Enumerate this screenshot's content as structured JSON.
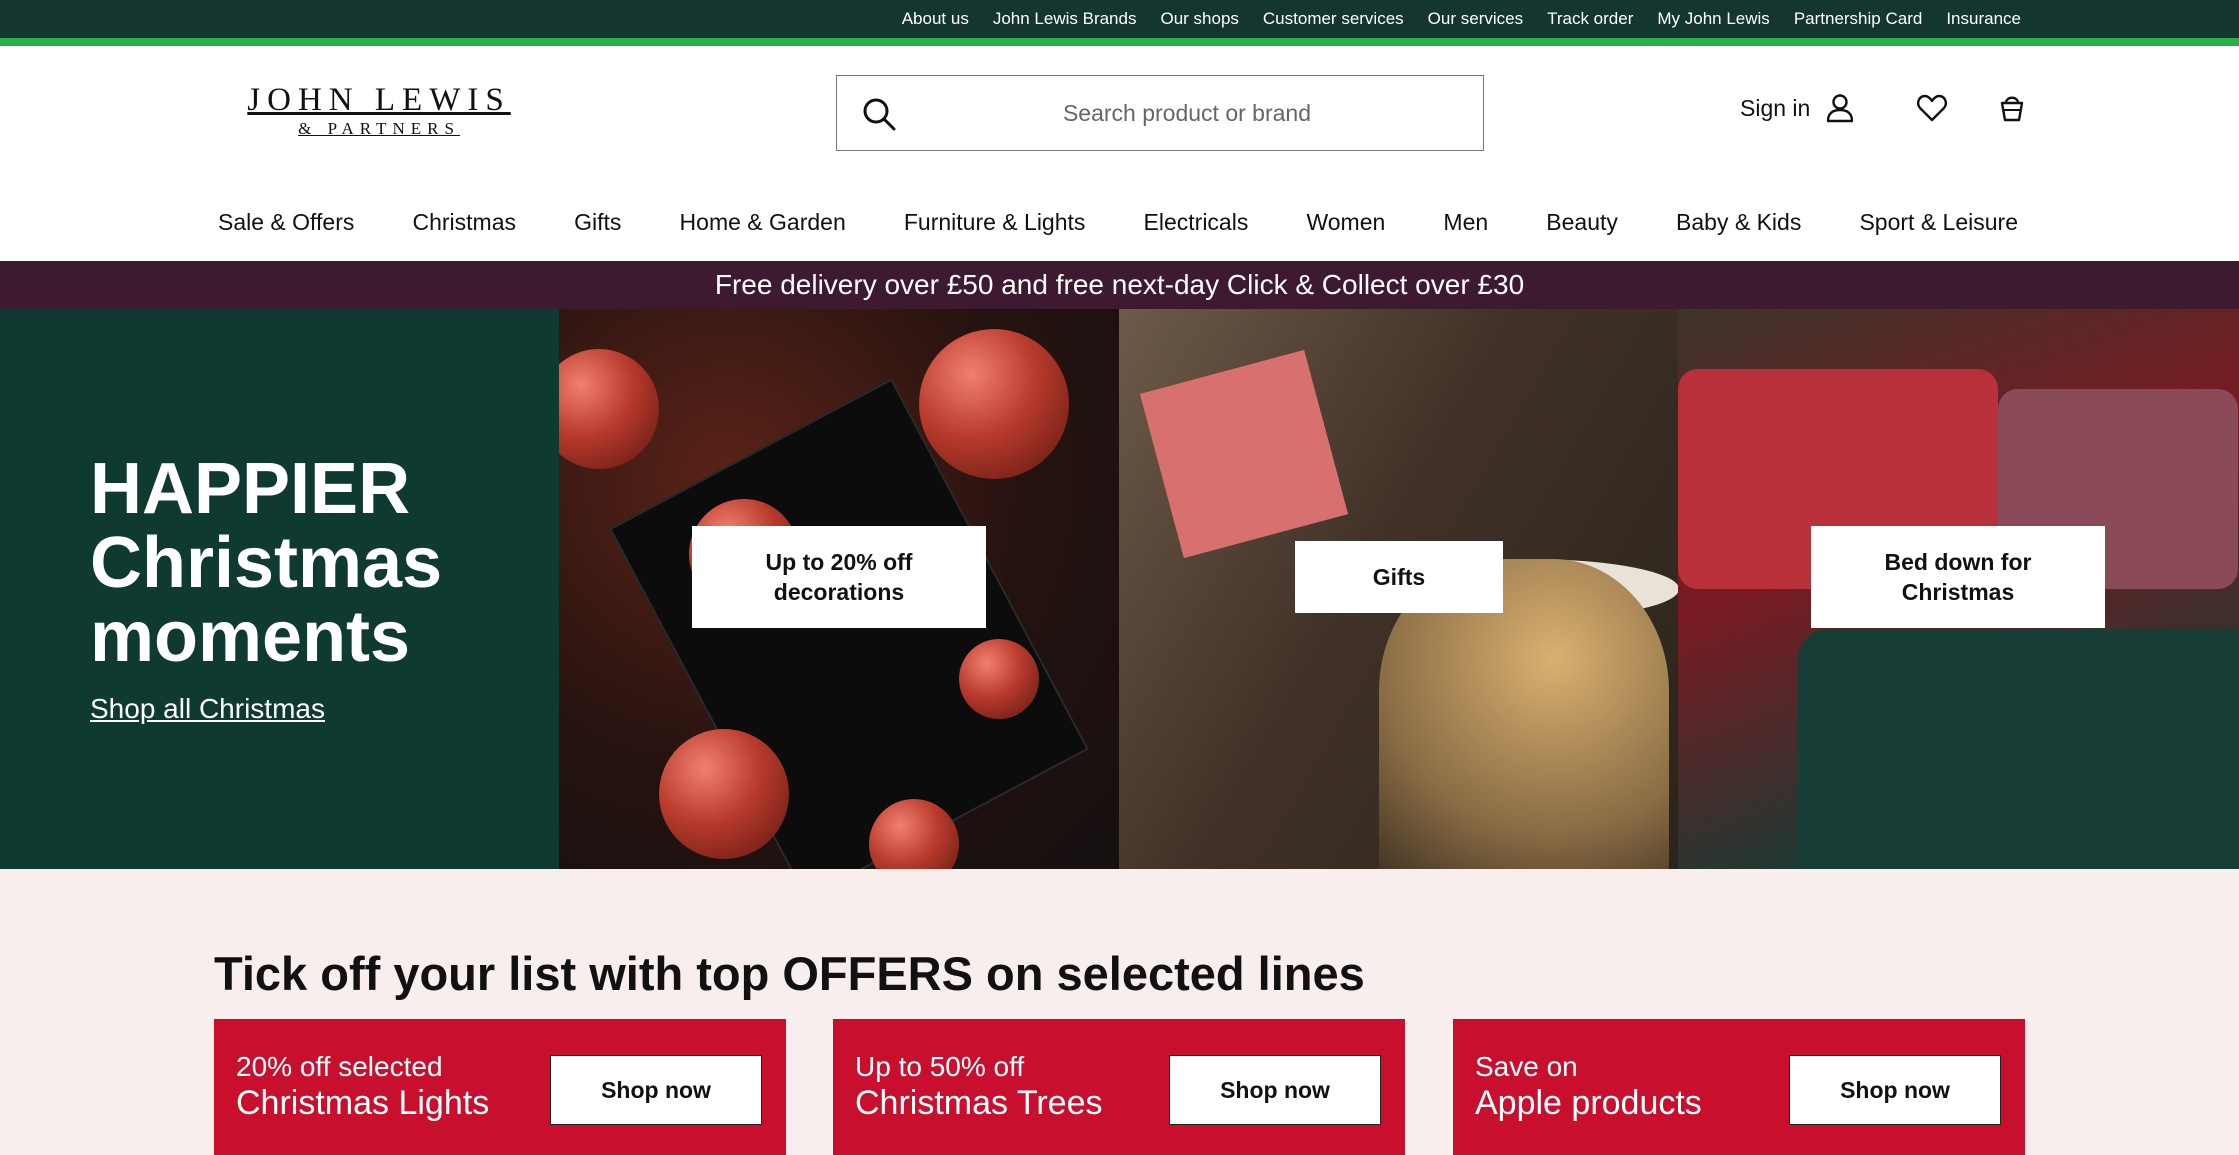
{
  "utility_nav": [
    "About us",
    "John Lewis Brands",
    "Our shops",
    "Customer services",
    "Our services",
    "Track order",
    "My John Lewis",
    "Partnership Card",
    "Insurance"
  ],
  "logo": {
    "line1": "JOHN LEWIS",
    "line2": "& PARTNERS"
  },
  "search": {
    "placeholder": "Search product or brand"
  },
  "account": {
    "sign_in": "Sign in"
  },
  "main_nav": [
    "Sale & Offers",
    "Christmas",
    "Gifts",
    "Home & Garden",
    "Furniture & Lights",
    "Electricals",
    "Women",
    "Men",
    "Beauty",
    "Baby & Kids",
    "Sport & Leisure"
  ],
  "promo": "Free delivery over £50 and free next-day Click & Collect over £30",
  "hero": {
    "title_line1": "HAPPIER",
    "title_line2": "Christmas",
    "title_line3": "moments",
    "link": "Shop all Christmas",
    "tiles": [
      {
        "label_line1": "Up to 20% off",
        "label_line2": "decorations"
      },
      {
        "label_line1": "Gifts",
        "label_line2": ""
      },
      {
        "label_line1": "Bed down for",
        "label_line2": "Christmas"
      }
    ]
  },
  "offers": {
    "heading": "Tick off your list with top OFFERS on selected lines",
    "cards": [
      {
        "small": "20% off selected",
        "big": "Christmas Lights",
        "button": "Shop now"
      },
      {
        "small": "Up to 50% off",
        "big": "Christmas Trees",
        "button": "Shop now"
      },
      {
        "small": "Save on",
        "big": "Apple products",
        "button": "Shop now"
      }
    ]
  },
  "colors": {
    "utility_bg": "#143530",
    "accent": "#2ab24a",
    "promo_bg": "#3e1a30",
    "hero_bg": "#0f3a31",
    "offer_red": "#c8102e",
    "offers_bg": "#f8eeee"
  }
}
